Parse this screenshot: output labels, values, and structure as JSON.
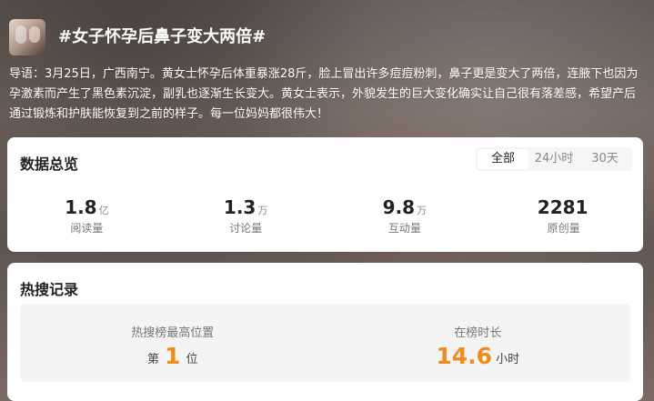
{
  "header": {
    "title": "#女子怀孕后鼻子变大两倍#"
  },
  "intro": {
    "text": "导语：3月25日，广西南宁。黄女士怀孕后体重暴涨28斤，脸上冒出许多痘痘粉刺，鼻子更是变大了两倍，连腋下也因为孕激素而产生了黑色素沉淀，副乳也逐渐生长变大。黄女士表示，外貌发生的巨大变化确实让自己很有落差感，希望产后通过锻炼和护肤能恢复到之前的样子。每一位妈妈都很伟大！"
  },
  "overview": {
    "title": "数据总览",
    "tabs": [
      {
        "label": "全部"
      },
      {
        "label": "24小时"
      },
      {
        "label": "30天"
      }
    ],
    "stats": [
      {
        "value": "1.8",
        "unit": "亿",
        "label": "阅读量"
      },
      {
        "value": "1.3",
        "unit": "万",
        "label": "讨论量"
      },
      {
        "value": "9.8",
        "unit": "万",
        "label": "互动量"
      },
      {
        "value": "2281",
        "unit": "",
        "label": "原创量"
      }
    ]
  },
  "hot_search": {
    "title": "热搜记录",
    "peak_position": {
      "caption": "热搜榜最高位置",
      "prefix": "第",
      "value": "1",
      "suffix": "位"
    },
    "duration": {
      "caption": "在榜时长",
      "value": "14.6",
      "unit": "小时"
    }
  }
}
